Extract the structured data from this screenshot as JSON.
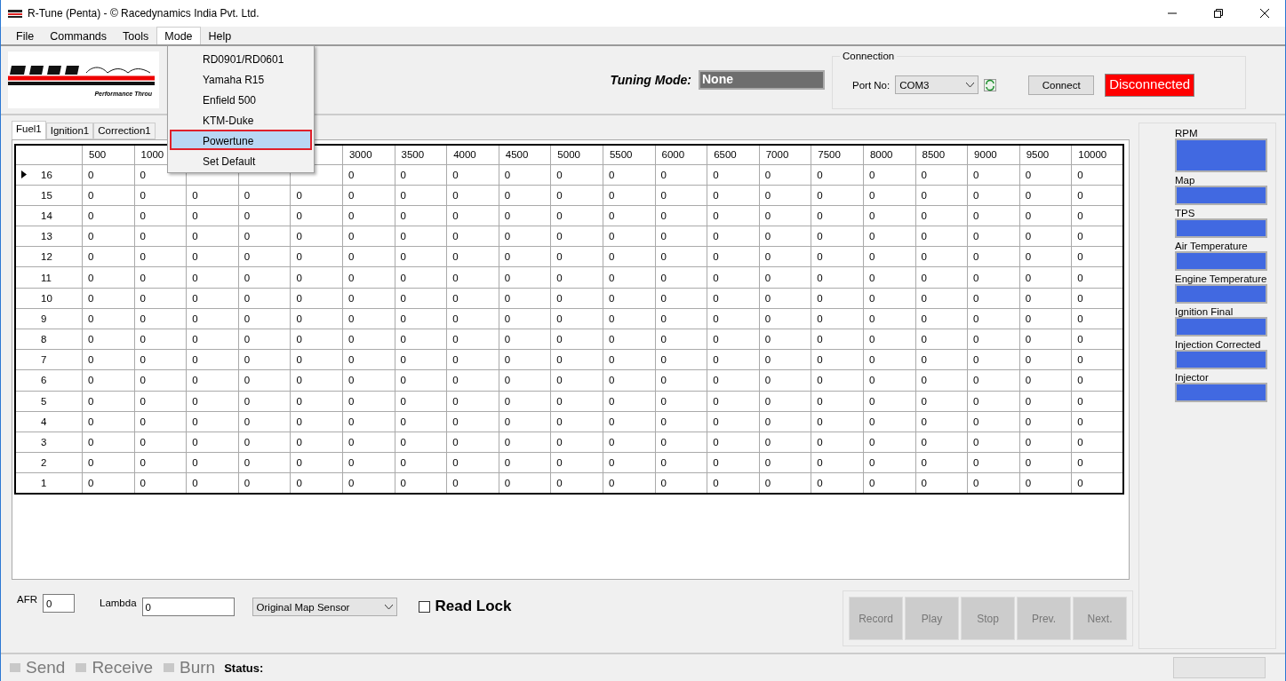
{
  "window": {
    "title": "R-Tune (Penta) - © Racedynamics India Pvt. Ltd."
  },
  "menu_bar": [
    {
      "label": "File",
      "selected": false
    },
    {
      "label": "Commands",
      "selected": false
    },
    {
      "label": "Tools",
      "selected": false
    },
    {
      "label": "Mode",
      "selected": true
    },
    {
      "label": "Help",
      "selected": false
    }
  ],
  "mode_menu": [
    {
      "label": "RD0901/RD0601",
      "selected": false
    },
    {
      "label": "Yamaha R15",
      "selected": false
    },
    {
      "label": "Enfield 500",
      "selected": false
    },
    {
      "label": "KTM-Duke",
      "selected": false
    },
    {
      "label": "Powertune",
      "selected": true
    },
    {
      "label": "Set Default",
      "selected": false
    }
  ],
  "logo": {
    "tagline": "Performance Throu"
  },
  "tuning_mode": {
    "label": "Tuning Mode:",
    "value": "None"
  },
  "connection": {
    "title": "Connection",
    "port_label": "Port No:",
    "port": "COM3",
    "button": "Connect",
    "status": "Disconnected"
  },
  "tabs": [
    {
      "label": "Fuel1",
      "selected": true
    },
    {
      "label": "Ignition1",
      "selected": false
    },
    {
      "label": "Correction1",
      "selected": false
    }
  ],
  "table": {
    "columns": [
      "500",
      "1000",
      null,
      null,
      null,
      "3000",
      "3500",
      "4000",
      "4500",
      "5000",
      "5500",
      "6000",
      "6500",
      "7000",
      "7500",
      "8000",
      "8500",
      "9000",
      "9500",
      "10000"
    ],
    "rows": [
      {
        "label": "16",
        "selected": true,
        "cells": [
          "0",
          "0",
          null,
          null,
          null,
          "0",
          "0",
          "0",
          "0",
          "0",
          "0",
          "0",
          "0",
          "0",
          "0",
          "0",
          "0",
          "0",
          "0",
          "0"
        ]
      },
      {
        "label": "15",
        "selected": false,
        "cells": [
          "0",
          "0",
          "0",
          "0",
          "0",
          "0",
          "0",
          "0",
          "0",
          "0",
          "0",
          "0",
          "0",
          "0",
          "0",
          "0",
          "0",
          "0",
          "0",
          "0"
        ]
      },
      {
        "label": "14",
        "selected": false,
        "cells": [
          "0",
          "0",
          "0",
          "0",
          "0",
          "0",
          "0",
          "0",
          "0",
          "0",
          "0",
          "0",
          "0",
          "0",
          "0",
          "0",
          "0",
          "0",
          "0",
          "0"
        ]
      },
      {
        "label": "13",
        "selected": false,
        "cells": [
          "0",
          "0",
          "0",
          "0",
          "0",
          "0",
          "0",
          "0",
          "0",
          "0",
          "0",
          "0",
          "0",
          "0",
          "0",
          "0",
          "0",
          "0",
          "0",
          "0"
        ]
      },
      {
        "label": "12",
        "selected": false,
        "cells": [
          "0",
          "0",
          "0",
          "0",
          "0",
          "0",
          "0",
          "0",
          "0",
          "0",
          "0",
          "0",
          "0",
          "0",
          "0",
          "0",
          "0",
          "0",
          "0",
          "0"
        ]
      },
      {
        "label": "11",
        "selected": false,
        "cells": [
          "0",
          "0",
          "0",
          "0",
          "0",
          "0",
          "0",
          "0",
          "0",
          "0",
          "0",
          "0",
          "0",
          "0",
          "0",
          "0",
          "0",
          "0",
          "0",
          "0"
        ]
      },
      {
        "label": "10",
        "selected": false,
        "cells": [
          "0",
          "0",
          "0",
          "0",
          "0",
          "0",
          "0",
          "0",
          "0",
          "0",
          "0",
          "0",
          "0",
          "0",
          "0",
          "0",
          "0",
          "0",
          "0",
          "0"
        ]
      },
      {
        "label": "9",
        "selected": false,
        "cells": [
          "0",
          "0",
          "0",
          "0",
          "0",
          "0",
          "0",
          "0",
          "0",
          "0",
          "0",
          "0",
          "0",
          "0",
          "0",
          "0",
          "0",
          "0",
          "0",
          "0"
        ]
      },
      {
        "label": "8",
        "selected": false,
        "cells": [
          "0",
          "0",
          "0",
          "0",
          "0",
          "0",
          "0",
          "0",
          "0",
          "0",
          "0",
          "0",
          "0",
          "0",
          "0",
          "0",
          "0",
          "0",
          "0",
          "0"
        ]
      },
      {
        "label": "7",
        "selected": false,
        "cells": [
          "0",
          "0",
          "0",
          "0",
          "0",
          "0",
          "0",
          "0",
          "0",
          "0",
          "0",
          "0",
          "0",
          "0",
          "0",
          "0",
          "0",
          "0",
          "0",
          "0"
        ]
      },
      {
        "label": "6",
        "selected": false,
        "cells": [
          "0",
          "0",
          "0",
          "0",
          "0",
          "0",
          "0",
          "0",
          "0",
          "0",
          "0",
          "0",
          "0",
          "0",
          "0",
          "0",
          "0",
          "0",
          "0",
          "0"
        ]
      },
      {
        "label": "5",
        "selected": false,
        "cells": [
          "0",
          "0",
          "0",
          "0",
          "0",
          "0",
          "0",
          "0",
          "0",
          "0",
          "0",
          "0",
          "0",
          "0",
          "0",
          "0",
          "0",
          "0",
          "0",
          "0"
        ]
      },
      {
        "label": "4",
        "selected": false,
        "cells": [
          "0",
          "0",
          "0",
          "0",
          "0",
          "0",
          "0",
          "0",
          "0",
          "0",
          "0",
          "0",
          "0",
          "0",
          "0",
          "0",
          "0",
          "0",
          "0",
          "0"
        ]
      },
      {
        "label": "3",
        "selected": false,
        "cells": [
          "0",
          "0",
          "0",
          "0",
          "0",
          "0",
          "0",
          "0",
          "0",
          "0",
          "0",
          "0",
          "0",
          "0",
          "0",
          "0",
          "0",
          "0",
          "0",
          "0"
        ]
      },
      {
        "label": "2",
        "selected": false,
        "cells": [
          "0",
          "0",
          "0",
          "0",
          "0",
          "0",
          "0",
          "0",
          "0",
          "0",
          "0",
          "0",
          "0",
          "0",
          "0",
          "0",
          "0",
          "0",
          "0",
          "0"
        ]
      },
      {
        "label": "1",
        "selected": false,
        "cells": [
          "0",
          "0",
          "0",
          "0",
          "0",
          "0",
          "0",
          "0",
          "0",
          "0",
          "0",
          "0",
          "0",
          "0",
          "0",
          "0",
          "0",
          "0",
          "0",
          "0"
        ]
      }
    ]
  },
  "sensors": [
    {
      "label": "RPM",
      "kind": "tall"
    },
    {
      "label": "Map",
      "kind": "normal"
    },
    {
      "label": "TPS",
      "kind": "normal"
    },
    {
      "label": "Air Temperature",
      "kind": "normal"
    },
    {
      "label": "Engine Temperature",
      "kind": "normal"
    },
    {
      "label": "Ignition Final",
      "kind": "normal"
    },
    {
      "label": "Injection Corrected",
      "kind": "normal"
    },
    {
      "label": "Injector",
      "kind": "normal"
    }
  ],
  "afr": {
    "label": "AFR",
    "value": "0"
  },
  "lambda": {
    "label": "Lambda",
    "value": "0"
  },
  "sensor_select": {
    "value": "Original Map Sensor"
  },
  "read_lock": {
    "label": "Read Lock",
    "checked": false
  },
  "playback_buttons": [
    {
      "label": "Record",
      "disabled": true
    },
    {
      "label": "Play",
      "disabled": true
    },
    {
      "label": "Stop",
      "disabled": true
    },
    {
      "label": "Prev.",
      "disabled": true
    },
    {
      "label": "Next.",
      "disabled": true
    }
  ],
  "toolbar": [
    {
      "label": "Send",
      "disabled": true
    },
    {
      "label": "Receive",
      "disabled": true
    },
    {
      "label": "Burn",
      "disabled": true
    }
  ],
  "status": {
    "label": "Status:"
  }
}
